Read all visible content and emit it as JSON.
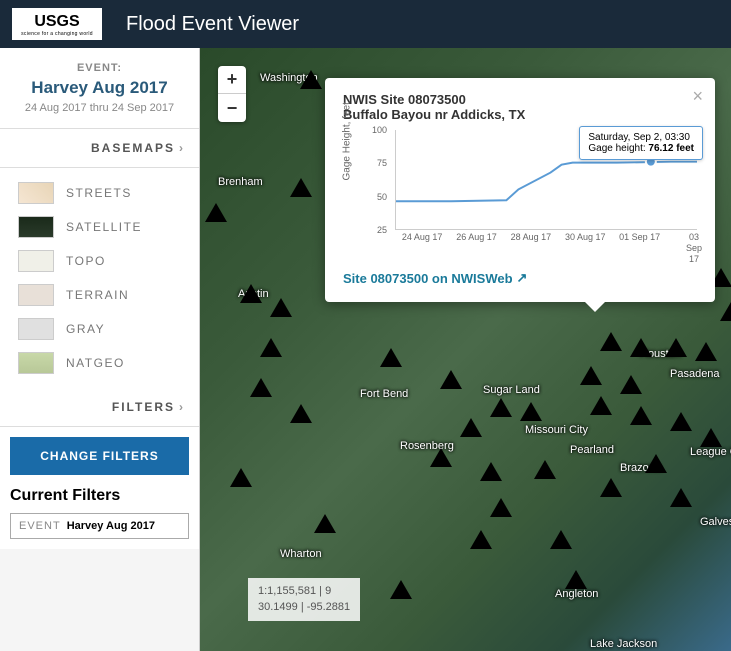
{
  "header": {
    "app_title": "Flood Event Viewer",
    "logo_text": "USGS",
    "logo_tagline": "science for a changing world"
  },
  "event": {
    "label": "EVENT:",
    "name": "Harvey Aug 2017",
    "dates": "24 Aug 2017 thru 24 Sep 2017"
  },
  "basemaps": {
    "header": "BASEMAPS",
    "items": [
      "STREETS",
      "SATELLITE",
      "TOPO",
      "TERRAIN",
      "GRAY",
      "NATGEO"
    ]
  },
  "filters": {
    "header": "FILTERS",
    "change_btn": "CHANGE FILTERS",
    "current_title": "Current Filters",
    "chip_label": "EVENT",
    "chip_value": "Harvey Aug 2017"
  },
  "coords": {
    "line1": "1:1,155,581 | 9",
    "line2": "30.1499 | -95.2881"
  },
  "zoom": {
    "in": "+",
    "out": "−"
  },
  "popup": {
    "title": "NWIS Site 08073500",
    "subtitle": "Buffalo Bayou nr Addicks, TX",
    "tooltip_date": "Saturday, Sep 2, 03:30",
    "tooltip_label": "Gage height:",
    "tooltip_value": "76.12 feet",
    "link_text": "Site 08073500 on NWISWeb",
    "ylabel": "Gage Height, feet"
  },
  "chart_data": {
    "type": "line",
    "ylabel": "Gage Height, feet",
    "ylim": [
      25,
      100
    ],
    "yticks": [
      25,
      50,
      75,
      100
    ],
    "x_categories": [
      "24 Aug 17",
      "26 Aug 17",
      "28 Aug 17",
      "30 Aug 17",
      "01 Sep 17",
      "03 Sep 17"
    ],
    "series": [
      {
        "name": "Gage height",
        "x": [
          0,
          1,
          2,
          2.2,
          2.8,
          3,
          3.2,
          4,
          5,
          5.5
        ],
        "y": [
          46,
          46,
          47,
          55,
          68,
          74,
          75,
          75,
          76,
          76
        ]
      }
    ],
    "highlight": {
      "x_index": 4.6,
      "date": "Saturday, Sep 2, 03:30",
      "value": 76.12,
      "unit": "feet"
    }
  },
  "cities": [
    "Washington",
    "Brenham",
    "Austin",
    "Fort Bend",
    "Sugar Land",
    "Missouri City",
    "Rosenberg",
    "Pearland",
    "Brazoria",
    "Pasadena",
    "League City",
    "Galveston",
    "Wharton",
    "Angleton",
    "Lake Jackson",
    "Houston"
  ]
}
